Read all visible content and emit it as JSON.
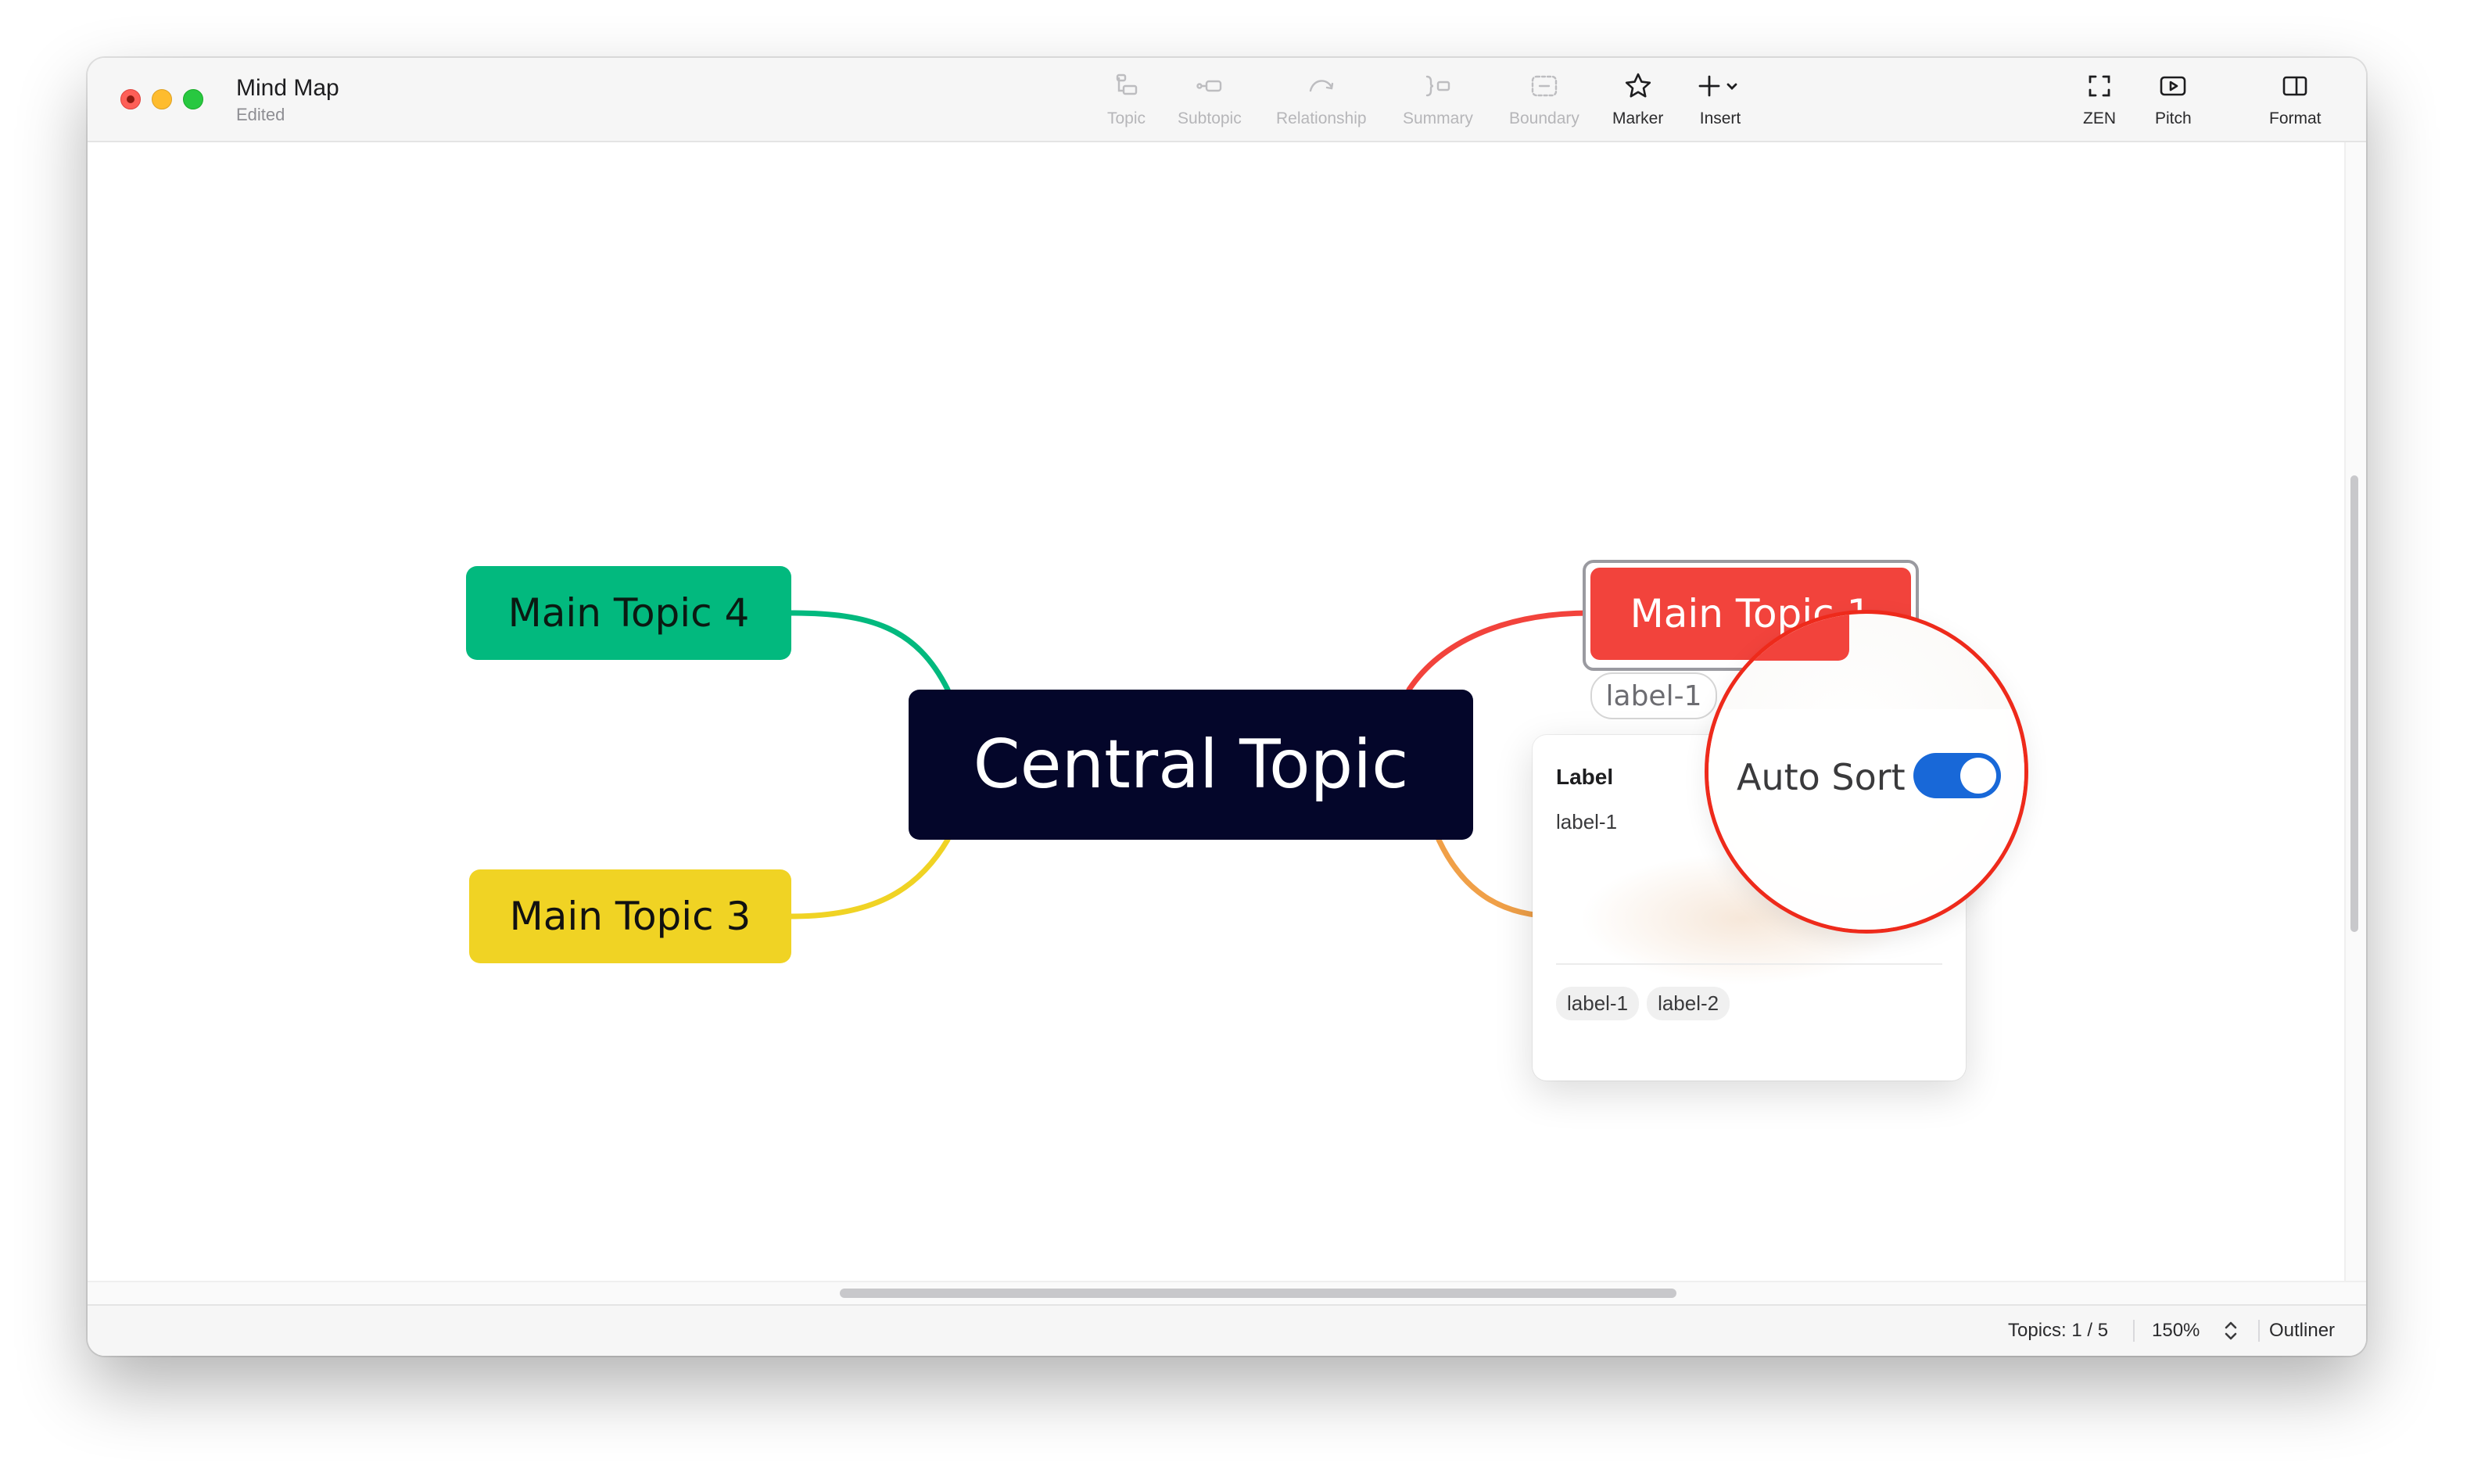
{
  "window": {
    "title": "Mind Map",
    "subtitle": "Edited"
  },
  "toolbar": {
    "topic": "Topic",
    "subtopic": "Subtopic",
    "relationship": "Relationship",
    "summary": "Summary",
    "boundary": "Boundary",
    "marker": "Marker",
    "insert": "Insert",
    "zen": "ZEN",
    "pitch": "Pitch",
    "format": "Format"
  },
  "mindmap": {
    "central": "Central Topic",
    "topic1": "Main Topic 1",
    "topic3": "Main Topic 3",
    "topic4": "Main Topic 4",
    "topic1_label": "label-1"
  },
  "label_popover": {
    "title": "Label",
    "current": "label-1",
    "tags": [
      "label-1",
      "label-2"
    ],
    "auto_sort_label": "Auto Sort",
    "auto_sort_on": true
  },
  "statusbar": {
    "topics": "Topics: 1 / 5",
    "zoom": "150%",
    "outliner": "Outliner"
  },
  "colors": {
    "central": "#04062a",
    "topic1": "#f2433c",
    "topic3": "#f0d324",
    "topic4": "#02b97e",
    "toggle_on": "#1868d8",
    "magnifier_ring": "#ee2a1b"
  }
}
